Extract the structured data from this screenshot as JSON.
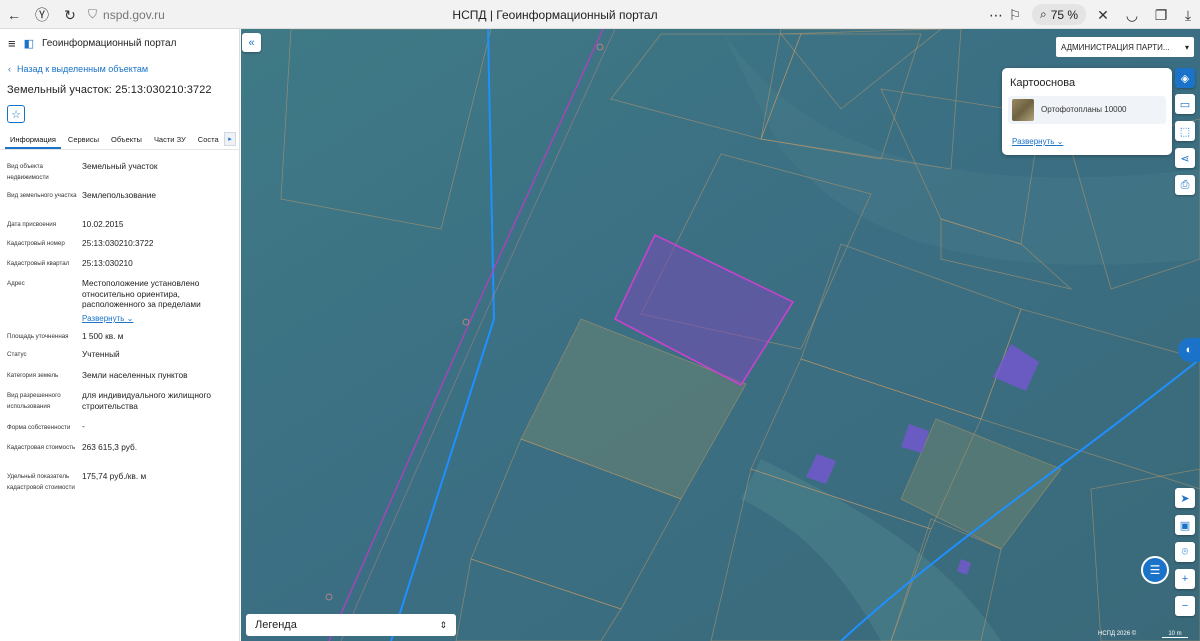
{
  "browser": {
    "url": "nspd.gov.ru",
    "tab_title": "НСПД | Геоинформационный портал",
    "zoom": "75 %"
  },
  "sidebar": {
    "portal_title": "Геоинформационный портал",
    "back_label": "Назад к выделенным объектам",
    "parcel_title": "Земельный участок: 25:13:030210:3722",
    "tabs": [
      "Информация",
      "Сервисы",
      "Объекты",
      "Части ЗУ",
      "Соста"
    ],
    "rows": [
      {
        "label": "Вид объекта недвижимости",
        "value": "Земельный участок"
      },
      {
        "label": "Вид земельного участка",
        "value": "Землепользование"
      },
      {
        "label": "Дата присвоения",
        "value": "10.02.2015"
      },
      {
        "label": "Кадастровый номер",
        "value": "25:13:030210:3722"
      },
      {
        "label": "Кадастровый квартал",
        "value": "25:13:030210"
      },
      {
        "label": "Адрес",
        "value": "Местоположение установлено относительно ориентира, расположенного за пределами"
      },
      {
        "label": "Площадь уточненная",
        "value": "1 500 кв. м"
      },
      {
        "label": "Статус",
        "value": "Учтенный"
      },
      {
        "label": "Категория земель",
        "value": "Земли населенных пунктов"
      },
      {
        "label": "Вид разрешенного использования",
        "value": "для индивидуального жилищного строительства"
      },
      {
        "label": "Форма собственности",
        "value": "-"
      },
      {
        "label": "Кадастровая стоимость",
        "value": "263 615,3 руб."
      },
      {
        "label": "Удельный показатель кадастровой стоимости",
        "value": "175,74 руб./кв. м"
      }
    ],
    "expand_label": "Развернуть"
  },
  "map": {
    "admin_select": "АДМИНИСТРАЦИЯ ПАРТИ...",
    "basemap_title": "Картооснова",
    "basemap_item": "Ортофотопланы 10000",
    "basemap_expand": "Развернуть",
    "legend_label": "Легенда",
    "copyright": "НСПД 2026 ©",
    "scale_label": "10 m",
    "colors": {
      "overlay": "#1f5f8a",
      "boundary": "#1e90ff",
      "selected": "#b040c0",
      "accent": "#1a73c8"
    }
  }
}
